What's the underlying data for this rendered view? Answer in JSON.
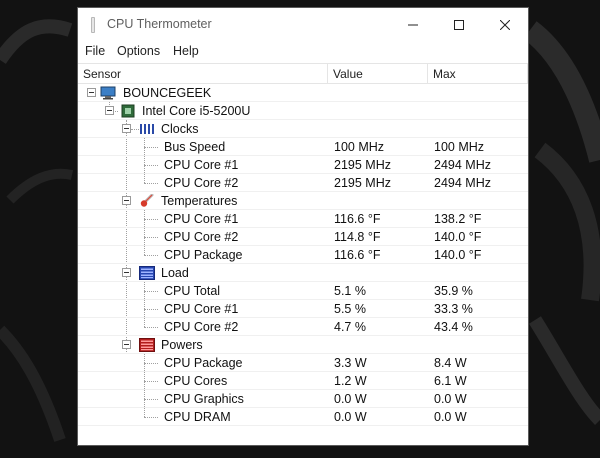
{
  "window": {
    "title": "CPU Thermometer"
  },
  "menu": {
    "file": "File",
    "options": "Options",
    "help": "Help"
  },
  "columns": {
    "sensor": "Sensor",
    "value": "Value",
    "max": "Max"
  },
  "tree": {
    "computer": "BOUNCEGEEK",
    "cpu": "Intel Core i5-5200U",
    "clocks": {
      "label": "Clocks",
      "rows": [
        {
          "name": "Bus Speed",
          "value": "100 MHz",
          "max": "100 MHz"
        },
        {
          "name": "CPU Core #1",
          "value": "2195 MHz",
          "max": "2494 MHz"
        },
        {
          "name": "CPU Core #2",
          "value": "2195 MHz",
          "max": "2494 MHz"
        }
      ]
    },
    "temperatures": {
      "label": "Temperatures",
      "rows": [
        {
          "name": "CPU Core #1",
          "value": "116.6 °F",
          "max": "138.2 °F"
        },
        {
          "name": "CPU Core #2",
          "value": "114.8 °F",
          "max": "140.0 °F"
        },
        {
          "name": "CPU Package",
          "value": "116.6 °F",
          "max": "140.0 °F"
        }
      ]
    },
    "load": {
      "label": "Load",
      "rows": [
        {
          "name": "CPU Total",
          "value": "5.1 %",
          "max": "35.9 %"
        },
        {
          "name": "CPU Core #1",
          "value": "5.5 %",
          "max": "33.3 %"
        },
        {
          "name": "CPU Core #2",
          "value": "4.7 %",
          "max": "43.4 %"
        }
      ]
    },
    "powers": {
      "label": "Powers",
      "rows": [
        {
          "name": "CPU Package",
          "value": "3.3 W",
          "max": "8.4 W"
        },
        {
          "name": "CPU Cores",
          "value": "1.2 W",
          "max": "6.1 W"
        },
        {
          "name": "CPU Graphics",
          "value": "0.0 W",
          "max": "0.0 W"
        },
        {
          "name": "CPU DRAM",
          "value": "0.0 W",
          "max": "0.0 W"
        }
      ]
    }
  }
}
